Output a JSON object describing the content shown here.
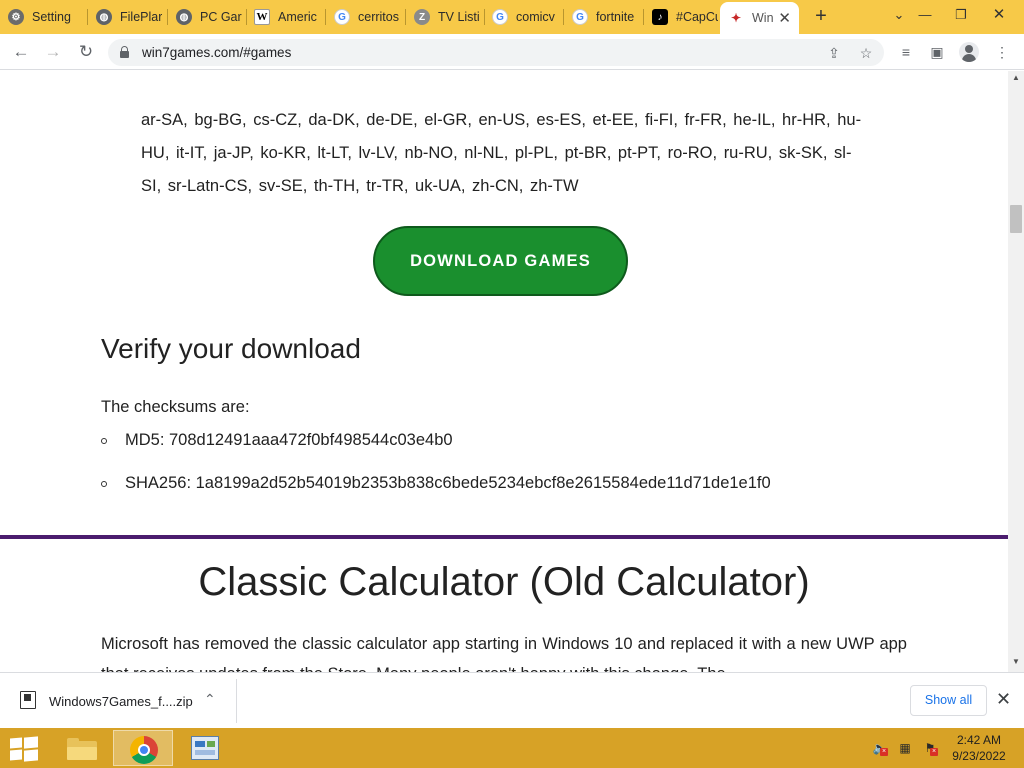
{
  "browser": {
    "tabs": [
      {
        "label": "Setting",
        "icon": "gear-icon",
        "color": "#5f6368"
      },
      {
        "label": "FilePlar",
        "icon": "globe-icon",
        "color": "#5f6368"
      },
      {
        "label": "PC Gar",
        "icon": "globe-icon",
        "color": "#5f6368"
      },
      {
        "label": "Americ",
        "icon": "wikipedia-icon",
        "color": "#ffffff"
      },
      {
        "label": "cerritos",
        "icon": "google-icon",
        "color": "#4285f4"
      },
      {
        "label": "TV Listi",
        "icon": "z-icon",
        "color": "#5f6368"
      },
      {
        "label": "comicv",
        "icon": "google-icon",
        "color": "#4285f4"
      },
      {
        "label": "fortnite",
        "icon": "google-icon",
        "color": "#4285f4"
      },
      {
        "label": "#CapCu",
        "icon": "tiktok-icon",
        "color": "#000000"
      },
      {
        "label": "Win",
        "icon": "win7games-icon",
        "color": "#c62828",
        "active": true
      }
    ],
    "address": {
      "url": "win7games.com/#games"
    }
  },
  "page": {
    "languages_text": "ar-SA, bg-BG, cs-CZ, da-DK, de-DE, el-GR, en-US, es-ES, et-EE, fi-FI, fr-FR, he-IL, hr-HR, hu-HU, it-IT, ja-JP, ko-KR, lt-LT, lv-LV, nb-NO, nl-NL, pl-PL, pt-BR, pt-PT, ro-RO, ru-RU, sk-SK, sl-SI, sr-Latn-CS, sv-SE, th-TH, tr-TR, uk-UA, zh-CN, zh-TW",
    "download_button": "DOWNLOAD GAMES",
    "verify_heading": "Verify your download",
    "checksums_intro": "The checksums are:",
    "md5": "MD5: 708d12491aaa472f0bf498544c03e4b0",
    "sha256": "SHA256: 1a8199a2d52b54019b2353b838c6bede5234ebcf8e2615584ede11d71de1e1f0",
    "calc_heading": "Classic Calculator (Old Calculator)",
    "calc_paragraph": "Microsoft has removed the classic calculator app starting in Windows 10 and replaced it with a new UWP app that receives updates from the Store. Many people aren't happy with this change. The",
    "accent_color": "#1a8f2e",
    "rule_color": "#4b1c6e"
  },
  "downloads": {
    "file_name": "Windows7Games_f....zip",
    "show_all": "Show all"
  },
  "taskbar": {
    "time": "2:42 AM",
    "date": "9/23/2022"
  }
}
